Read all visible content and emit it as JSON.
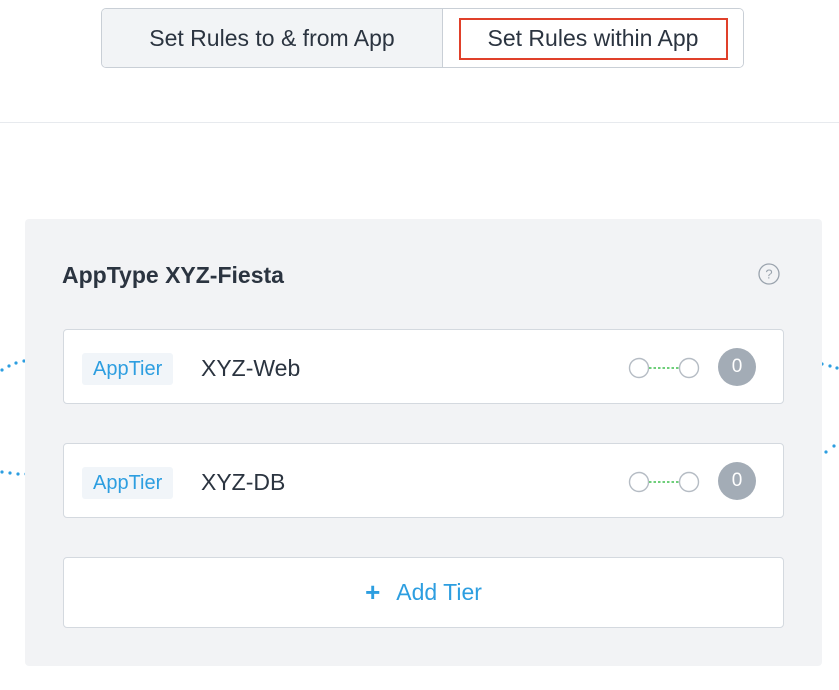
{
  "segmented_control": {
    "left_label": "Set Rules to & from App",
    "right_label": "Set Rules within App"
  },
  "panel": {
    "title": "AppType XYZ-Fiesta",
    "help_icon": "question-circle-icon",
    "tiers": [
      {
        "badge": "AppTier",
        "name": "XYZ-Web",
        "count": "0"
      },
      {
        "badge": "AppTier",
        "name": "XYZ-DB",
        "count": "0"
      }
    ],
    "add_tier_icon": "+",
    "add_tier_label": "Add Tier"
  },
  "colors": {
    "accent_blue": "#2d9ee0",
    "highlight_red": "#e0402a",
    "connector_green": "#3fbf4f",
    "panel_bg": "#f2f3f5",
    "count_bg": "#a3acb6"
  }
}
